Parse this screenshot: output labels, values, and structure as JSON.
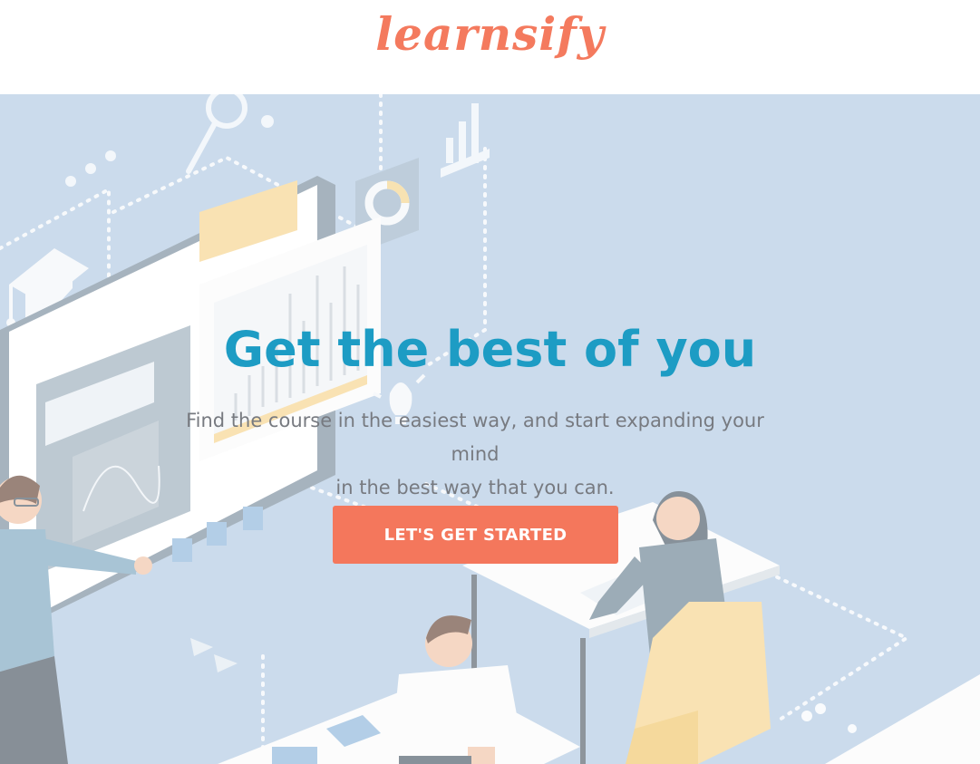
{
  "header": {
    "logo_text": "learnsify"
  },
  "hero": {
    "headline": "Get the best of you",
    "subtitle_line1": "Find the course in the easiest way, and start expanding your mind",
    "subtitle_line2": "in the best way that you can.",
    "cta_label": "LET'S GET STARTED"
  },
  "colors": {
    "brand": "#f47a5e",
    "headline": "#1d9cc4",
    "subtitle": "#777a80",
    "hero_bg": "#b3cbe3",
    "cta_bg": "#f4775c"
  },
  "illustration": {
    "description_icons": [
      "graduation-cap-icon",
      "magnifier-icon",
      "bar-chart-icon",
      "donut-chart-icon",
      "lightbulb-icon",
      "play-icon"
    ]
  }
}
